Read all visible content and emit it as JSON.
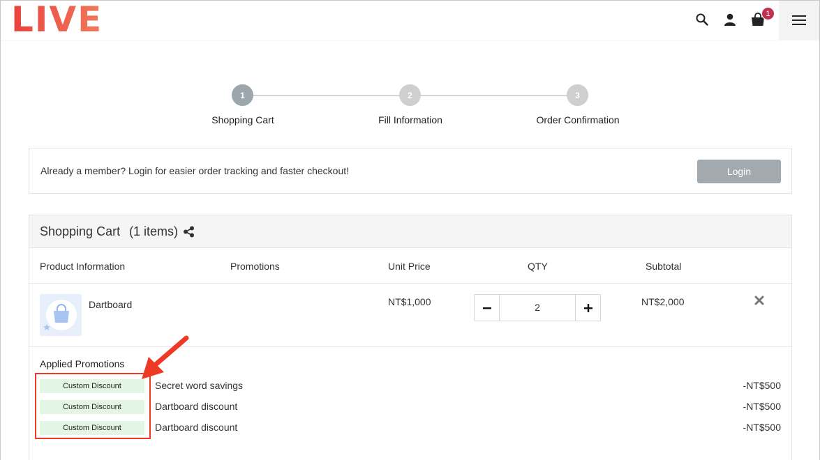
{
  "header": {
    "logo_text": "LIVE",
    "cart_badge": "1",
    "icons": [
      "search-icon",
      "user-icon",
      "shopping-bag-icon",
      "hamburger-menu-icon"
    ]
  },
  "stepper": {
    "steps": [
      {
        "number": "1",
        "label": "Shopping Cart"
      },
      {
        "number": "2",
        "label": "Fill Information"
      },
      {
        "number": "3",
        "label": "Order Confirmation"
      }
    ]
  },
  "login_banner": {
    "message": "Already a member? Login for easier order tracking and faster checkout!",
    "button_label": "Login"
  },
  "cart": {
    "title": "Shopping Cart",
    "count": "(1 items)",
    "columns": [
      "Product Information",
      "Promotions",
      "Unit Price",
      "QTY",
      "Subtotal"
    ],
    "items": [
      {
        "name": "Dartboard",
        "unit_price": "NT$1,000",
        "qty": "2",
        "subtotal": "NT$2,000"
      }
    ],
    "applied_promotions_title": "Applied Promotions",
    "promotions": [
      {
        "tag": "Custom Discount",
        "description": "Secret word savings",
        "amount": "-NT$500"
      },
      {
        "tag": "Custom Discount",
        "description": "Dartboard discount",
        "amount": "-NT$500"
      },
      {
        "tag": "Custom Discount",
        "description": "Dartboard discount",
        "amount": "-NT$500"
      }
    ]
  },
  "colors": {
    "logo_red": "#e8423d",
    "badge": "#c2304f",
    "login_button": "#a3aaaf",
    "promo_tag_bg": "#e3f6e6",
    "annotation": "#ee3a24"
  }
}
